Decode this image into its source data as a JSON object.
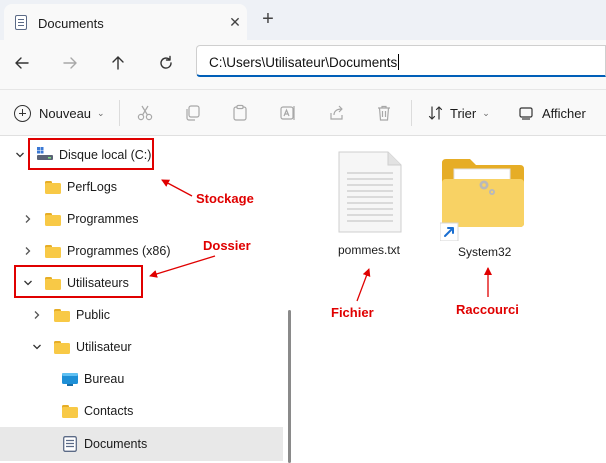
{
  "tab": {
    "title": "Documents",
    "close": "✕",
    "new_tab": "+"
  },
  "address": {
    "path": "C:\\Users\\Utilisateur\\Documents"
  },
  "commands": {
    "new_label": "Nouveau",
    "sort_label": "Trier",
    "view_label": "Afficher",
    "dropdown_glyph": "⌄"
  },
  "tree": {
    "disk": "Disque local (C:)",
    "perflogs": "PerfLogs",
    "programmes": "Programmes",
    "programmes_x86": "Programmes (x86)",
    "utilisateurs": "Utilisateurs",
    "public": "Public",
    "utilisateur": "Utilisateur",
    "bureau": "Bureau",
    "contacts": "Contacts",
    "documents": "Documents"
  },
  "files": [
    {
      "name": "pommes.txt",
      "type": "text-file"
    },
    {
      "name": "System32",
      "type": "folder-shortcut"
    }
  ],
  "annotations": {
    "stockage": "Stockage",
    "dossier": "Dossier",
    "fichier": "Fichier",
    "raccourci": "Raccourci",
    "color": "#e00000"
  },
  "colors": {
    "accent": "#005fb8",
    "folder": "#f8c946",
    "selected_row": "#e8e8e8"
  }
}
